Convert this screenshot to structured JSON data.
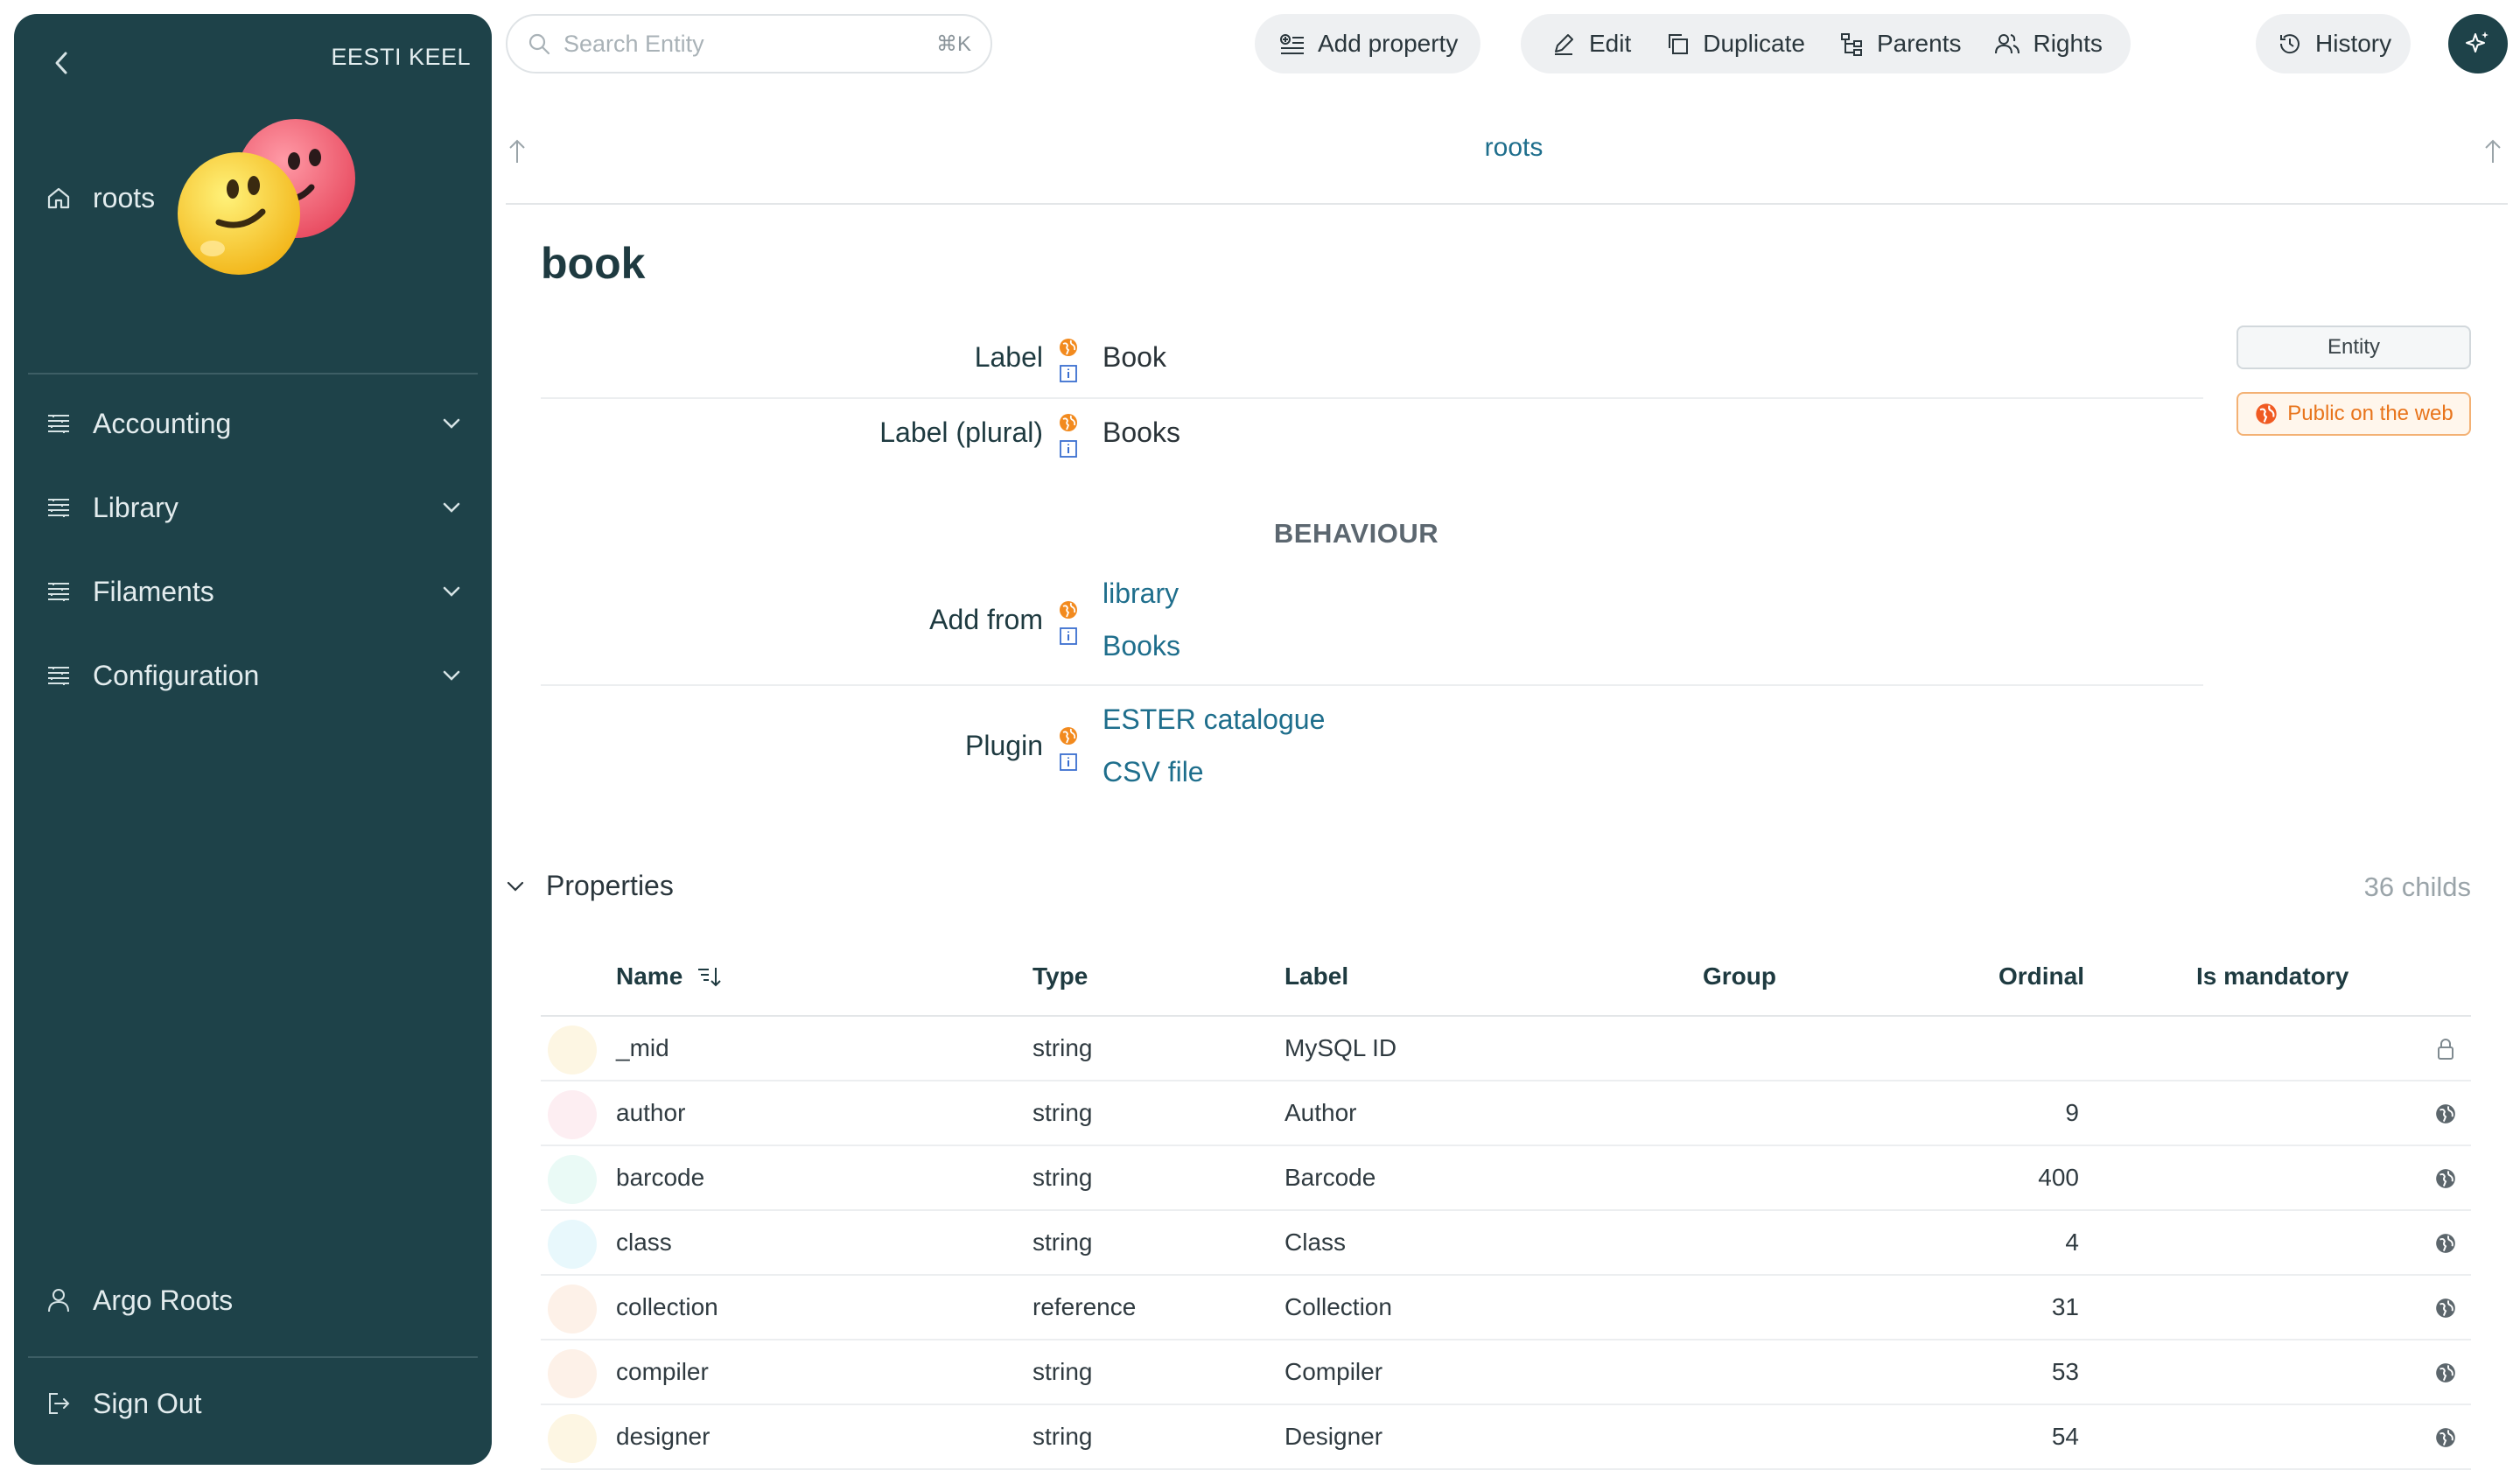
{
  "sidebar": {
    "language": "EESTI KEEL",
    "items": [
      {
        "label": "roots",
        "icon": "home-icon"
      },
      {
        "label": "Accounting",
        "icon": "list-icon"
      },
      {
        "label": "Library",
        "icon": "list-icon"
      },
      {
        "label": "Filaments",
        "icon": "list-icon"
      },
      {
        "label": "Configuration",
        "icon": "list-icon"
      }
    ],
    "user": "Argo Roots",
    "signout": "Sign Out"
  },
  "search": {
    "placeholder": "Search Entity",
    "shortcut": "⌘K"
  },
  "toolbar": {
    "add_property": "Add property",
    "edit": "Edit",
    "duplicate": "Duplicate",
    "parents": "Parents",
    "rights": "Rights",
    "history": "History"
  },
  "breadcrumb": "roots",
  "entity": {
    "title": "book",
    "label_name": "Label",
    "label_value": "Book",
    "plural_name": "Label (plural)",
    "plural_value": "Books",
    "section": "BEHAVIOUR",
    "add_from_name": "Add from",
    "add_from_values": [
      "library",
      "Books"
    ],
    "plugin_name": "Plugin",
    "plugin_values": [
      "ESTER catalogue",
      "CSV file"
    ],
    "badge_type": "Entity",
    "badge_public": "Public on the web"
  },
  "properties": {
    "title": "Properties",
    "count": "36 childs",
    "columns": [
      "Name",
      "Type",
      "Label",
      "Group",
      "Ordinal",
      "Is mandatory"
    ],
    "rows": [
      {
        "name": "_mid",
        "type": "string",
        "label": "MySQL ID",
        "ordinal": "",
        "icon": "lock-icon",
        "color": "#fdf6e3"
      },
      {
        "name": "author",
        "type": "string",
        "label": "Author",
        "ordinal": "9",
        "icon": "globe-icon",
        "color": "#fdeef2"
      },
      {
        "name": "barcode",
        "type": "string",
        "label": "Barcode",
        "ordinal": "400",
        "icon": "globe-icon",
        "color": "#eafaf6"
      },
      {
        "name": "class",
        "type": "string",
        "label": "Class",
        "ordinal": "4",
        "icon": "globe-icon",
        "color": "#e8f8fc"
      },
      {
        "name": "collection",
        "type": "reference",
        "label": "Collection",
        "ordinal": "31",
        "icon": "globe-icon",
        "color": "#fdf1e8"
      },
      {
        "name": "compiler",
        "type": "string",
        "label": "Compiler",
        "ordinal": "53",
        "icon": "globe-icon",
        "color": "#fdf1e8"
      },
      {
        "name": "designer",
        "type": "string",
        "label": "Designer",
        "ordinal": "54",
        "icon": "globe-icon",
        "color": "#fdf6e3"
      }
    ]
  },
  "colors": {
    "sidebar_bg": "#1e4249",
    "link": "#1e6e8c",
    "public_orange": "#e8741b"
  }
}
